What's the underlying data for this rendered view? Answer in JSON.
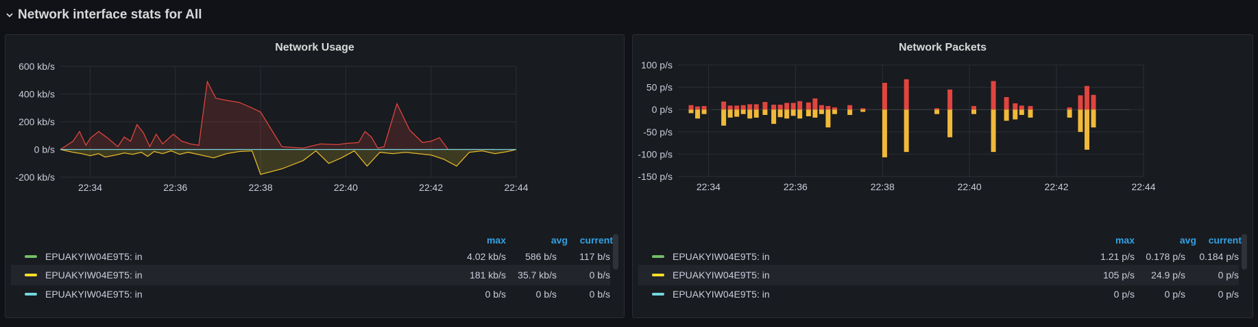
{
  "row": {
    "title": "Network interface stats for All",
    "collapse_icon": "chevron-down-icon"
  },
  "legend_headers": {
    "max": "max",
    "avg": "avg",
    "current": "current"
  },
  "panels": [
    {
      "title": "Network Usage",
      "y_ticks": [
        "600 kb/s",
        "400 kb/s",
        "200 kb/s",
        "0 b/s",
        "-200 kb/s"
      ],
      "x_ticks": [
        "22:34",
        "22:36",
        "22:38",
        "22:40",
        "22:42",
        "22:44"
      ],
      "legend": [
        {
          "name": "EPUAKYIW04E9T5: in",
          "color": "#73bf69",
          "max": "4.02 kb/s",
          "avg": "586 b/s",
          "current": "117 b/s"
        },
        {
          "name": "EPUAKYIW04E9T5: in",
          "color": "#fade2a",
          "max": "181 kb/s",
          "avg": "35.7 kb/s",
          "current": "0 b/s"
        },
        {
          "name": "EPUAKYIW04E9T5: in",
          "color": "#5794f2",
          "max": "0 b/s",
          "avg": "0 b/s",
          "current": "0 b/s"
        }
      ]
    },
    {
      "title": "Network Packets",
      "y_ticks": [
        "100 p/s",
        "50 p/s",
        "0 p/s",
        "-50 p/s",
        "-100 p/s",
        "-150 p/s"
      ],
      "x_ticks": [
        "22:34",
        "22:36",
        "22:38",
        "22:40",
        "22:42",
        "22:44"
      ],
      "legend": [
        {
          "name": "EPUAKYIW04E9T5: in",
          "color": "#73bf69",
          "max": "1.21 p/s",
          "avg": "0.178 p/s",
          "current": "0.184 p/s"
        },
        {
          "name": "EPUAKYIW04E9T5: in",
          "color": "#fade2a",
          "max": "105 p/s",
          "avg": "24.9 p/s",
          "current": "0 p/s"
        },
        {
          "name": "EPUAKYIW04E9T5: in",
          "color": "#5794f2",
          "max": "0 p/s",
          "avg": "0 p/s",
          "current": "0 p/s"
        }
      ]
    }
  ],
  "chart_data": [
    {
      "type": "area",
      "title": "Network Usage",
      "ylim": [
        -200,
        600
      ],
      "y_unit": "kb/s",
      "x_range": [
        "22:33.3",
        "22:44"
      ],
      "series": [
        {
          "name": "EPUAKYIW04E9T5: in",
          "color": "#e0453f",
          "x": [
            33.3,
            33.6,
            33.75,
            33.9,
            34.0,
            34.2,
            34.4,
            34.65,
            34.8,
            34.95,
            35.1,
            35.25,
            35.4,
            35.55,
            35.7,
            35.95,
            36.15,
            36.35,
            36.55,
            36.75,
            36.95,
            37.2,
            37.5,
            37.8,
            38.0,
            38.5,
            39.0,
            39.4,
            39.8,
            40.05,
            40.3,
            40.45,
            40.6,
            40.75,
            40.9,
            41.2,
            41.5,
            41.8,
            42.0,
            42.2,
            42.4,
            42.6,
            42.8,
            42.95,
            43.1,
            43.25,
            43.5
          ],
          "y": [
            0,
            60,
            130,
            30,
            80,
            130,
            85,
            20,
            90,
            60,
            180,
            120,
            20,
            110,
            40,
            110,
            60,
            40,
            30,
            490,
            370,
            355,
            340,
            300,
            270,
            20,
            10,
            40,
            35,
            45,
            50,
            130,
            90,
            10,
            20,
            330,
            140,
            50,
            60,
            85,
            0,
            0,
            0,
            0,
            0,
            0,
            0
          ]
        },
        {
          "name": "EPUAKYIW04E9T5: in",
          "color": "#fade2a",
          "x": [
            33.3,
            33.6,
            33.8,
            34.0,
            34.2,
            34.35,
            34.6,
            34.8,
            35.0,
            35.2,
            35.35,
            35.5,
            35.7,
            35.9,
            36.1,
            36.3,
            36.6,
            36.9,
            37.2,
            37.5,
            37.8,
            38.0,
            38.5,
            39.0,
            39.3,
            39.6,
            39.9,
            40.2,
            40.5,
            40.8,
            41.1,
            41.4,
            41.7,
            42.0,
            42.3,
            42.6,
            42.9,
            43.2,
            43.5,
            43.8,
            44.0
          ],
          "y": [
            0,
            -20,
            -30,
            -45,
            -30,
            -55,
            -40,
            -25,
            -35,
            -20,
            -50,
            -15,
            -30,
            -10,
            -35,
            -20,
            -40,
            -60,
            -30,
            -15,
            -10,
            -180,
            -140,
            -80,
            -10,
            -100,
            -60,
            -10,
            -120,
            -20,
            -30,
            -20,
            -30,
            -40,
            -70,
            -120,
            -20,
            -10,
            -30,
            -15,
            0
          ]
        },
        {
          "name": "EPUAKYIW04E9T5: in",
          "color": "#5794f2",
          "x": [
            33.3,
            44.0
          ],
          "y": [
            0,
            0
          ]
        }
      ]
    },
    {
      "type": "bar",
      "title": "Network Packets",
      "ylim": [
        -150,
        100
      ],
      "y_unit": "p/s",
      "x_range": [
        "22:33.3",
        "22:44"
      ],
      "series": [
        {
          "name": "EPUAKYIW04E9T5: in",
          "color": "#e0453f",
          "x": [
            33.6,
            33.75,
            33.9,
            34.35,
            34.5,
            34.65,
            34.8,
            34.95,
            35.1,
            35.3,
            35.5,
            35.65,
            35.8,
            35.95,
            36.1,
            36.3,
            36.45,
            36.6,
            36.75,
            36.9,
            37.25,
            37.55,
            38.05,
            38.55,
            39.25,
            39.55,
            40.1,
            40.55,
            40.85,
            41.05,
            41.2,
            41.4,
            42.3,
            42.55,
            42.7,
            42.85
          ],
          "y": [
            10,
            7,
            8,
            18,
            9,
            9,
            10,
            12,
            12,
            17,
            11,
            11,
            15,
            15,
            19,
            16,
            25,
            10,
            8,
            5,
            10,
            3,
            60,
            68,
            3,
            45,
            8,
            64,
            28,
            14,
            9,
            8,
            5,
            32,
            53,
            33
          ]
        },
        {
          "name": "EPUAKYIW04E9T5: in",
          "color": "#fade2a",
          "x": [
            33.6,
            33.75,
            33.9,
            34.35,
            34.5,
            34.65,
            34.8,
            34.95,
            35.1,
            35.3,
            35.5,
            35.65,
            35.8,
            35.95,
            36.1,
            36.3,
            36.45,
            36.6,
            36.75,
            36.9,
            37.25,
            37.55,
            38.05,
            38.55,
            39.25,
            39.55,
            40.1,
            40.55,
            40.85,
            41.05,
            41.2,
            41.4,
            42.3,
            42.55,
            42.7,
            42.85
          ],
          "y": [
            -8,
            -20,
            -10,
            -36,
            -18,
            -16,
            -10,
            -20,
            -18,
            -12,
            -32,
            -17,
            -20,
            -14,
            -20,
            -15,
            -18,
            -10,
            -40,
            -10,
            -12,
            -5,
            -107,
            -95,
            -10,
            -62,
            -10,
            -95,
            -25,
            -22,
            -12,
            -18,
            -18,
            -50,
            -90,
            -40
          ]
        },
        {
          "name": "EPUAKYIW04E9T5: in",
          "color": "#5794f2",
          "x": [],
          "y": []
        }
      ]
    }
  ]
}
